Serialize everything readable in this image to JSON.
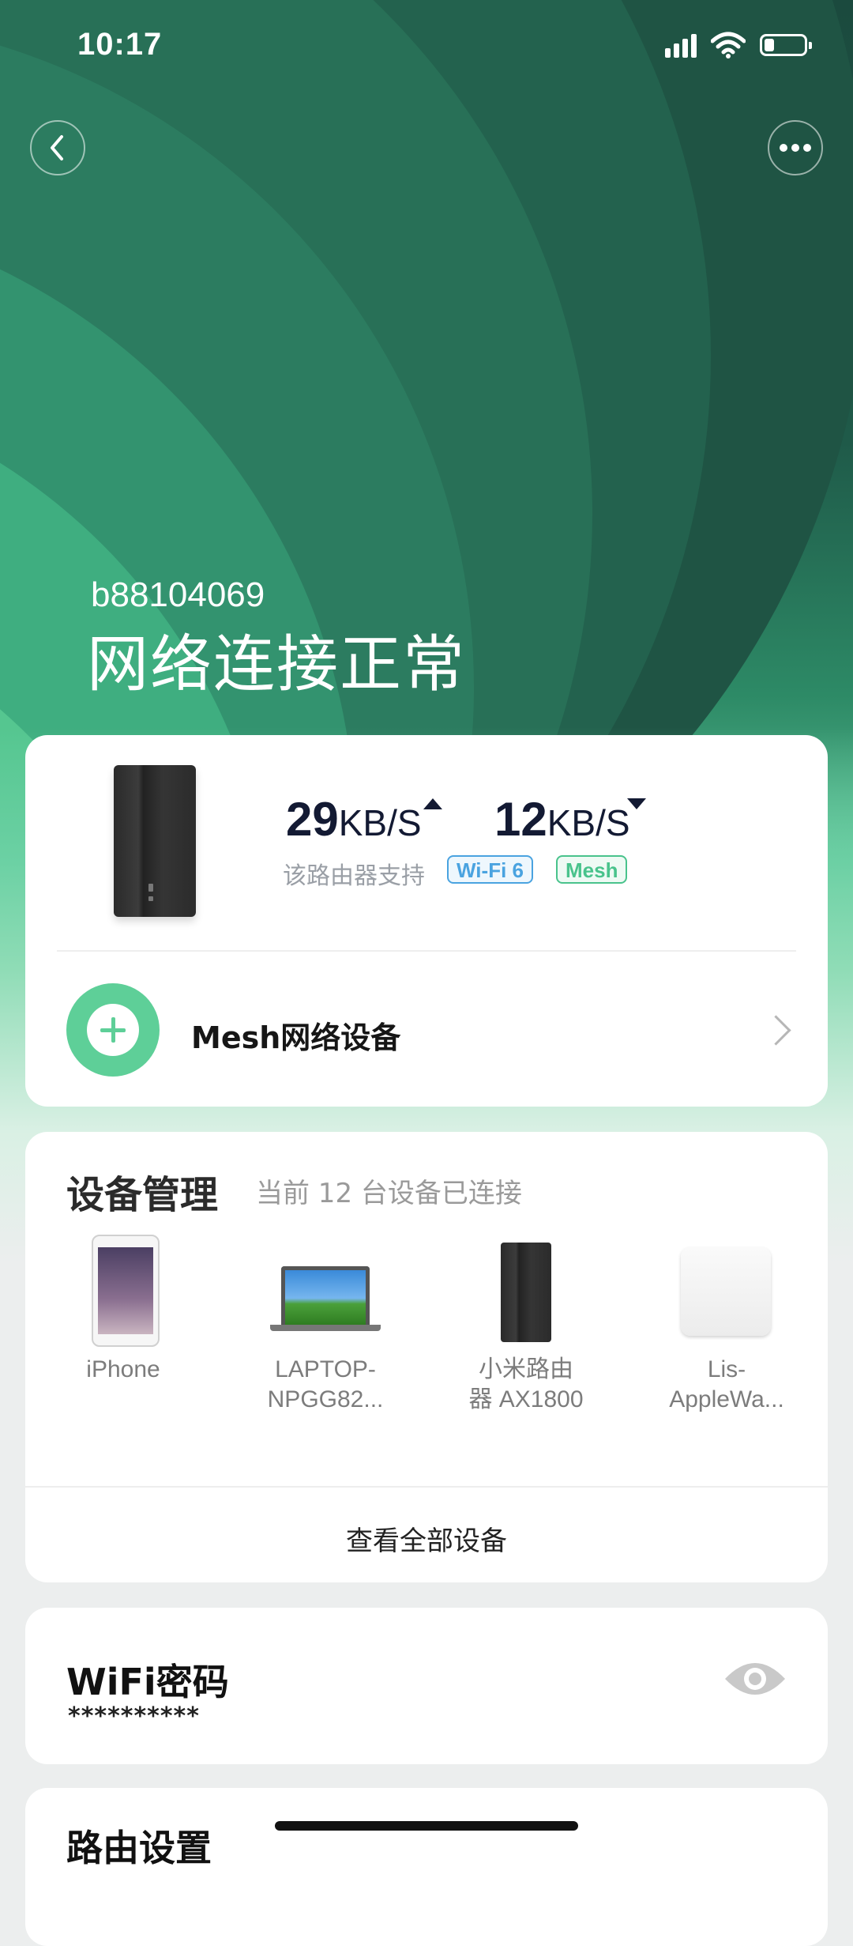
{
  "status_bar": {
    "time": "10:17",
    "icons": [
      "signal-icon",
      "wifi-icon",
      "battery-icon"
    ]
  },
  "header": {
    "back_icon": "chevron-left-icon",
    "more_icon": "more-horizontal-icon",
    "network_name": "b88104069",
    "status": "网络连接正常"
  },
  "router_card": {
    "upload_speed": "29",
    "upload_unit": "KB/S",
    "download_speed": "12",
    "download_unit": "KB/S",
    "support_text": "该路由器支持",
    "badge_wifi6": "Wi-Fi 6",
    "badge_mesh": "Mesh",
    "mesh_label": "Mesh网络设备",
    "colors": {
      "wifi6": "#4aa3e0",
      "mesh": "#49c38c"
    }
  },
  "devices": {
    "title": "设备管理",
    "subtitle": "当前 12 台设备已连接",
    "items": [
      {
        "line1": "iPhone",
        "line2": ""
      },
      {
        "line1": "LAPTOP-",
        "line2": "NPGG82..."
      },
      {
        "line1": "小米路由",
        "line2": "器 AX1800"
      },
      {
        "line1": "Lis-",
        "line2": "AppleWa..."
      }
    ],
    "view_all": "查看全部设备"
  },
  "wifi": {
    "title": "WiFi密码",
    "password_mask": "**********"
  },
  "router_settings": {
    "title": "路由设置"
  },
  "colors": {
    "hero_dark": "#1b4a3e",
    "hero_light": "#6fd2a6",
    "accent_green": "#5ecf98"
  }
}
